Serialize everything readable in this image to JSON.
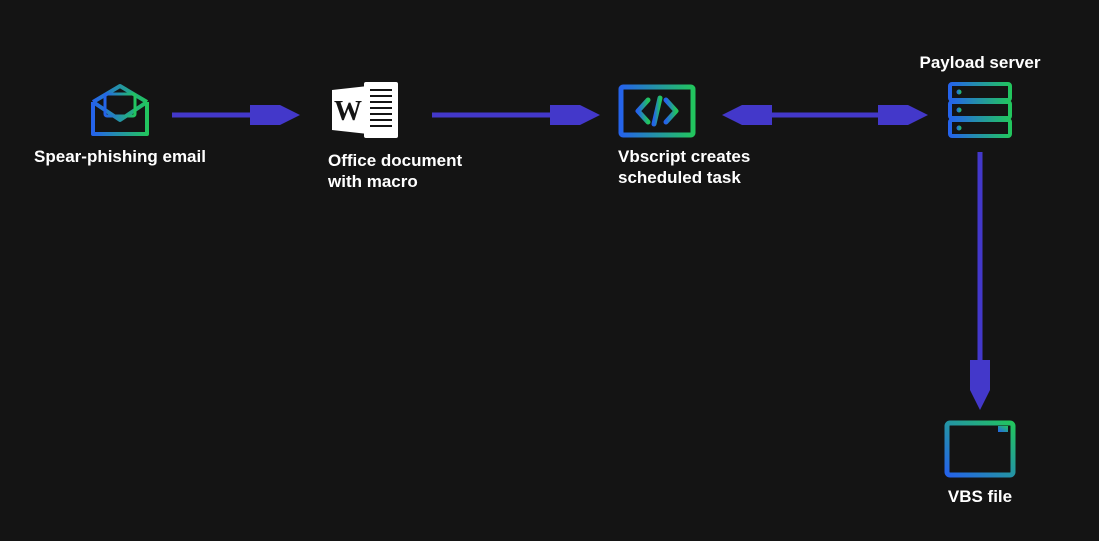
{
  "nodes": {
    "email": {
      "label": "Spear-phishing email"
    },
    "doc": {
      "label": "Office document\nwith macro"
    },
    "vbscript": {
      "label": "Vbscript creates\nscheduled task"
    },
    "server": {
      "label": "Payload server"
    },
    "vbsfile": {
      "label": "VBS file"
    }
  },
  "colors": {
    "gradient_start": "#2563eb",
    "gradient_end": "#22c55e",
    "arrow": "#4338ca",
    "bg": "#141414"
  }
}
